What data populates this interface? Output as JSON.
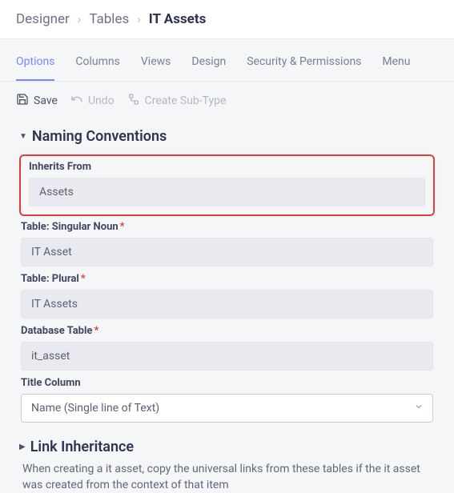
{
  "breadcrumb": {
    "items": [
      "Designer",
      "Tables",
      "IT Assets"
    ]
  },
  "tabs": {
    "items": [
      "Options",
      "Columns",
      "Views",
      "Design",
      "Security & Permissions",
      "Menu"
    ],
    "active": "Options"
  },
  "toolbar": {
    "save": "Save",
    "undo": "Undo",
    "create_subtype": "Create Sub-Type"
  },
  "sections": {
    "naming": {
      "title": "Naming Conventions",
      "fields": {
        "inherits_from": {
          "label": "Inherits From",
          "value": "Assets"
        },
        "singular": {
          "label": "Table: Singular Noun",
          "value": "IT Asset",
          "required": true
        },
        "plural": {
          "label": "Table: Plural",
          "value": "IT Assets",
          "required": true
        },
        "db_table": {
          "label": "Database Table",
          "value": "it_asset",
          "required": true
        },
        "title_col": {
          "label": "Title Column",
          "value": "Name (Single line of Text)"
        }
      }
    },
    "link_inheritance": {
      "title": "Link Inheritance",
      "description": "When creating a it asset, copy the universal links from these tables if the it asset was created from the context of that item"
    }
  }
}
